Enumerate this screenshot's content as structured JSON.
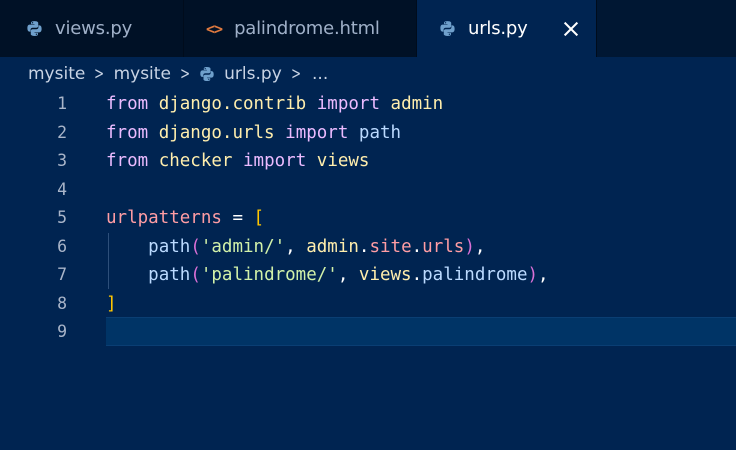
{
  "tabs": [
    {
      "label": "views.py",
      "icon": "python-icon"
    },
    {
      "label": "palindrome.html",
      "icon": "html-icon"
    },
    {
      "label": "urls.py",
      "icon": "python-icon",
      "active": true
    }
  ],
  "breadcrumb": {
    "items": [
      "mysite",
      "mysite",
      "urls.py"
    ],
    "ellipsis": "..."
  },
  "editor": {
    "line_numbers": [
      "1",
      "2",
      "3",
      "4",
      "5",
      "6",
      "7",
      "8",
      "9"
    ],
    "current_line": "9",
    "lines": [
      [
        [
          "kw",
          "from"
        ],
        [
          "plain",
          " "
        ],
        [
          "mod",
          "django.contrib"
        ],
        [
          "plain",
          " "
        ],
        [
          "kw",
          "import"
        ],
        [
          "plain",
          " "
        ],
        [
          "mod",
          "admin"
        ]
      ],
      [
        [
          "kw",
          "from"
        ],
        [
          "plain",
          " "
        ],
        [
          "mod",
          "django.urls"
        ],
        [
          "plain",
          " "
        ],
        [
          "kw",
          "import"
        ],
        [
          "plain",
          " "
        ],
        [
          "fn",
          "path"
        ]
      ],
      [
        [
          "kw",
          "from"
        ],
        [
          "plain",
          " "
        ],
        [
          "mod",
          "checker"
        ],
        [
          "plain",
          " "
        ],
        [
          "kw",
          "import"
        ],
        [
          "plain",
          " "
        ],
        [
          "mod",
          "views"
        ]
      ],
      [],
      [
        [
          "var",
          "urlpatterns"
        ],
        [
          "plain",
          " = "
        ],
        [
          "br",
          "["
        ]
      ],
      [
        [
          "plain",
          "    "
        ],
        [
          "fn",
          "path"
        ],
        [
          "br2",
          "("
        ],
        [
          "str",
          "'admin/'"
        ],
        [
          "plain",
          ", "
        ],
        [
          "mod",
          "admin"
        ],
        [
          "plain",
          "."
        ],
        [
          "var",
          "site"
        ],
        [
          "plain",
          "."
        ],
        [
          "var",
          "urls"
        ],
        [
          "br2",
          ")"
        ],
        [
          "plain",
          ","
        ]
      ],
      [
        [
          "plain",
          "    "
        ],
        [
          "fn",
          "path"
        ],
        [
          "br2",
          "("
        ],
        [
          "str",
          "'palindrome/'"
        ],
        [
          "plain",
          ", "
        ],
        [
          "mod",
          "views"
        ],
        [
          "plain",
          "."
        ],
        [
          "fn",
          "palindrome"
        ],
        [
          "br2",
          ")"
        ],
        [
          "plain",
          ","
        ]
      ],
      [
        [
          "br",
          "]"
        ]
      ],
      []
    ]
  },
  "colors": {
    "editor_bg": "#002451",
    "tabbar_bg": "#001733",
    "keyword": "#ebbbff",
    "module": "#ffeead",
    "variable": "#ff9da4",
    "function": "#bbdaff",
    "string": "#d1f1a9",
    "bracket": "#ffc600"
  }
}
